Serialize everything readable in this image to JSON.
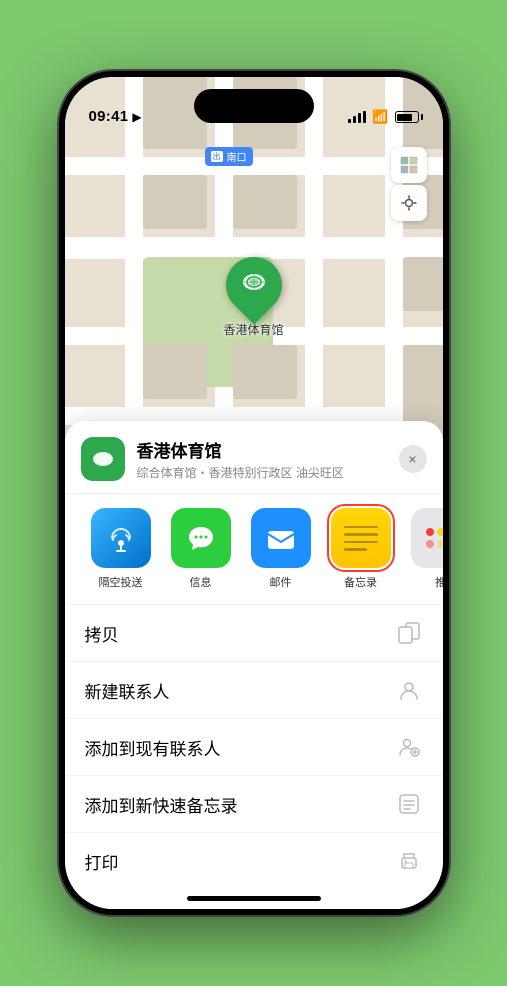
{
  "status_bar": {
    "time": "09:41",
    "location_arrow": "▶"
  },
  "map": {
    "label_text": "南口",
    "label_prefix": "出",
    "stadium_name": "香港体育馆",
    "controls": [
      "🗺",
      "↗"
    ]
  },
  "venue_panel": {
    "title": "香港体育馆",
    "subtitle": "综合体育馆・香港特别行政区 油尖旺区",
    "close_label": "×"
  },
  "share_actions": [
    {
      "id": "airdrop",
      "label": "隔空投送"
    },
    {
      "id": "messages",
      "label": "信息"
    },
    {
      "id": "mail",
      "label": "邮件"
    },
    {
      "id": "notes",
      "label": "备忘录"
    },
    {
      "id": "more",
      "label": "推"
    }
  ],
  "action_rows": [
    {
      "label": "拷贝",
      "icon": "copy"
    },
    {
      "label": "新建联系人",
      "icon": "person"
    },
    {
      "label": "添加到现有联系人",
      "icon": "person-add"
    },
    {
      "label": "添加到新快速备忘录",
      "icon": "note"
    },
    {
      "label": "打印",
      "icon": "print"
    }
  ],
  "more_dots": {
    "colors": [
      "#ff3b30",
      "#ffd60a",
      "#34c759"
    ]
  }
}
